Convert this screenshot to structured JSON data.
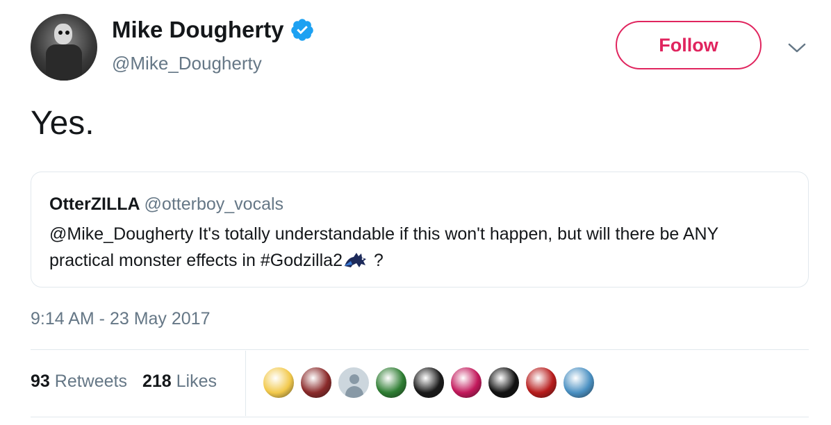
{
  "author": {
    "name": "Mike Dougherty",
    "handle": "@Mike_Dougherty",
    "verified": true,
    "verified_color": "#1da1f2"
  },
  "follow_button": {
    "label": "Follow",
    "color": "#e0245e"
  },
  "tweet": {
    "text": "Yes."
  },
  "quoted_tweet": {
    "name": "OtterZILLA",
    "handle": "@otterboy_vocals",
    "text_before": "@Mike_Dougherty It's totally understandable if this won't happen, but will there be ANY practical monster effects in ",
    "hashtag": "#Godzilla2",
    "emoji_icon": "godzilla-emoji-icon",
    "text_after": " ?"
  },
  "timestamp": "9:14 AM - 23 May 2017",
  "stats": {
    "retweets_count": "93",
    "retweets_label": "Retweets",
    "likes_count": "218",
    "likes_label": "Likes"
  },
  "likers": [
    {
      "icon": "anime-avatar-icon",
      "color": "#f2c94c"
    },
    {
      "icon": "person-avatar-icon",
      "color": "#8a2a2a"
    },
    {
      "icon": "default-egg-avatar-icon",
      "color": "#ccd6dd"
    },
    {
      "icon": "godzilla-avatar-icon",
      "color": "#2e7d32"
    },
    {
      "icon": "mw-logo-avatar-icon",
      "color": "#1a1a1a"
    },
    {
      "icon": "pink-abstract-avatar-icon",
      "color": "#c2185b"
    },
    {
      "icon": "face-avatar-icon",
      "color": "#111111"
    },
    {
      "icon": "flag-avatar-icon",
      "color": "#b71c1c"
    },
    {
      "icon": "car-avatar-icon",
      "color": "#4a90c2"
    }
  ]
}
